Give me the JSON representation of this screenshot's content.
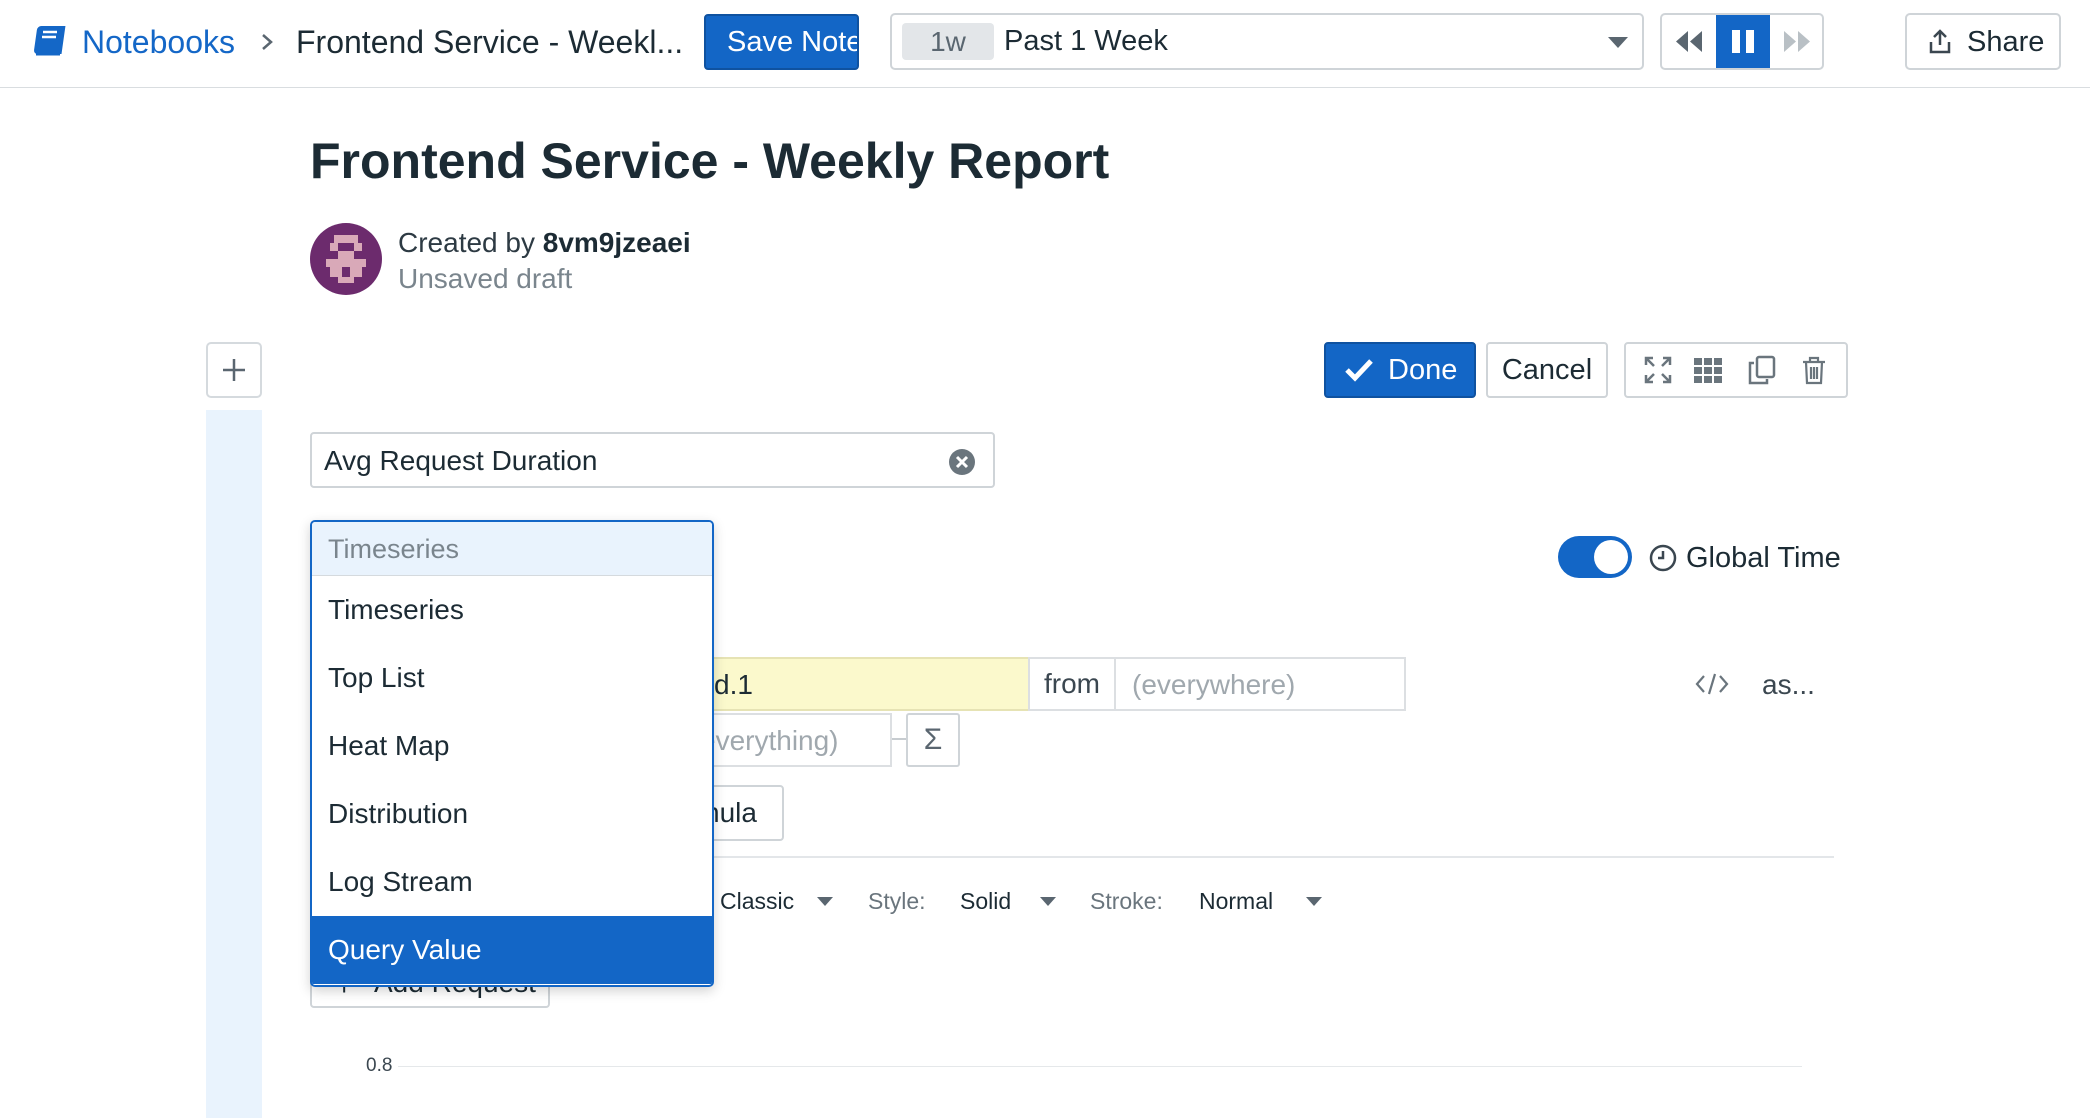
{
  "breadcrumb": {
    "root_label": "Notebooks",
    "current_label": "Frontend Service - Weekl..."
  },
  "toolbar": {
    "save_label": "Save Notebook",
    "time_chip": "1w",
    "time_label": "Past 1 Week",
    "share_label": "Share"
  },
  "notebook": {
    "title": "Frontend Service - Weekly Report",
    "created_by_prefix": "Created by ",
    "author": "8vm9jzeaei",
    "status": "Unsaved draft"
  },
  "cell": {
    "done_label": "Done",
    "cancel_label": "Cancel",
    "graph_title_value": "Avg Request Duration",
    "global_time_label": "Global Time",
    "global_time_enabled": true,
    "query": {
      "metric_partial": "d.1",
      "from_label": "from",
      "scope_placeholder": "(everywhere)",
      "avg_by_partial": "everything)",
      "as_label": "as...",
      "sigma": "Σ",
      "formula_partial": "nula"
    },
    "display": {
      "palette_value": "Classic",
      "style_label": "Style:",
      "style_value": "Solid",
      "stroke_label": "Stroke:",
      "stroke_value": "Normal"
    },
    "add_request_label": "Add Request",
    "chart_y_tick": "0.8"
  },
  "viz_dropdown": {
    "selected": "Timeseries",
    "options": [
      "Timeseries",
      "Top List",
      "Heat Map",
      "Distribution",
      "Log Stream",
      "Query Value"
    ],
    "highlighted": "Query Value"
  },
  "colors": {
    "accent": "#1366c6",
    "link": "#1467c7",
    "rail": "#e9f3fd",
    "metric_highlight": "#fbf9cc"
  }
}
